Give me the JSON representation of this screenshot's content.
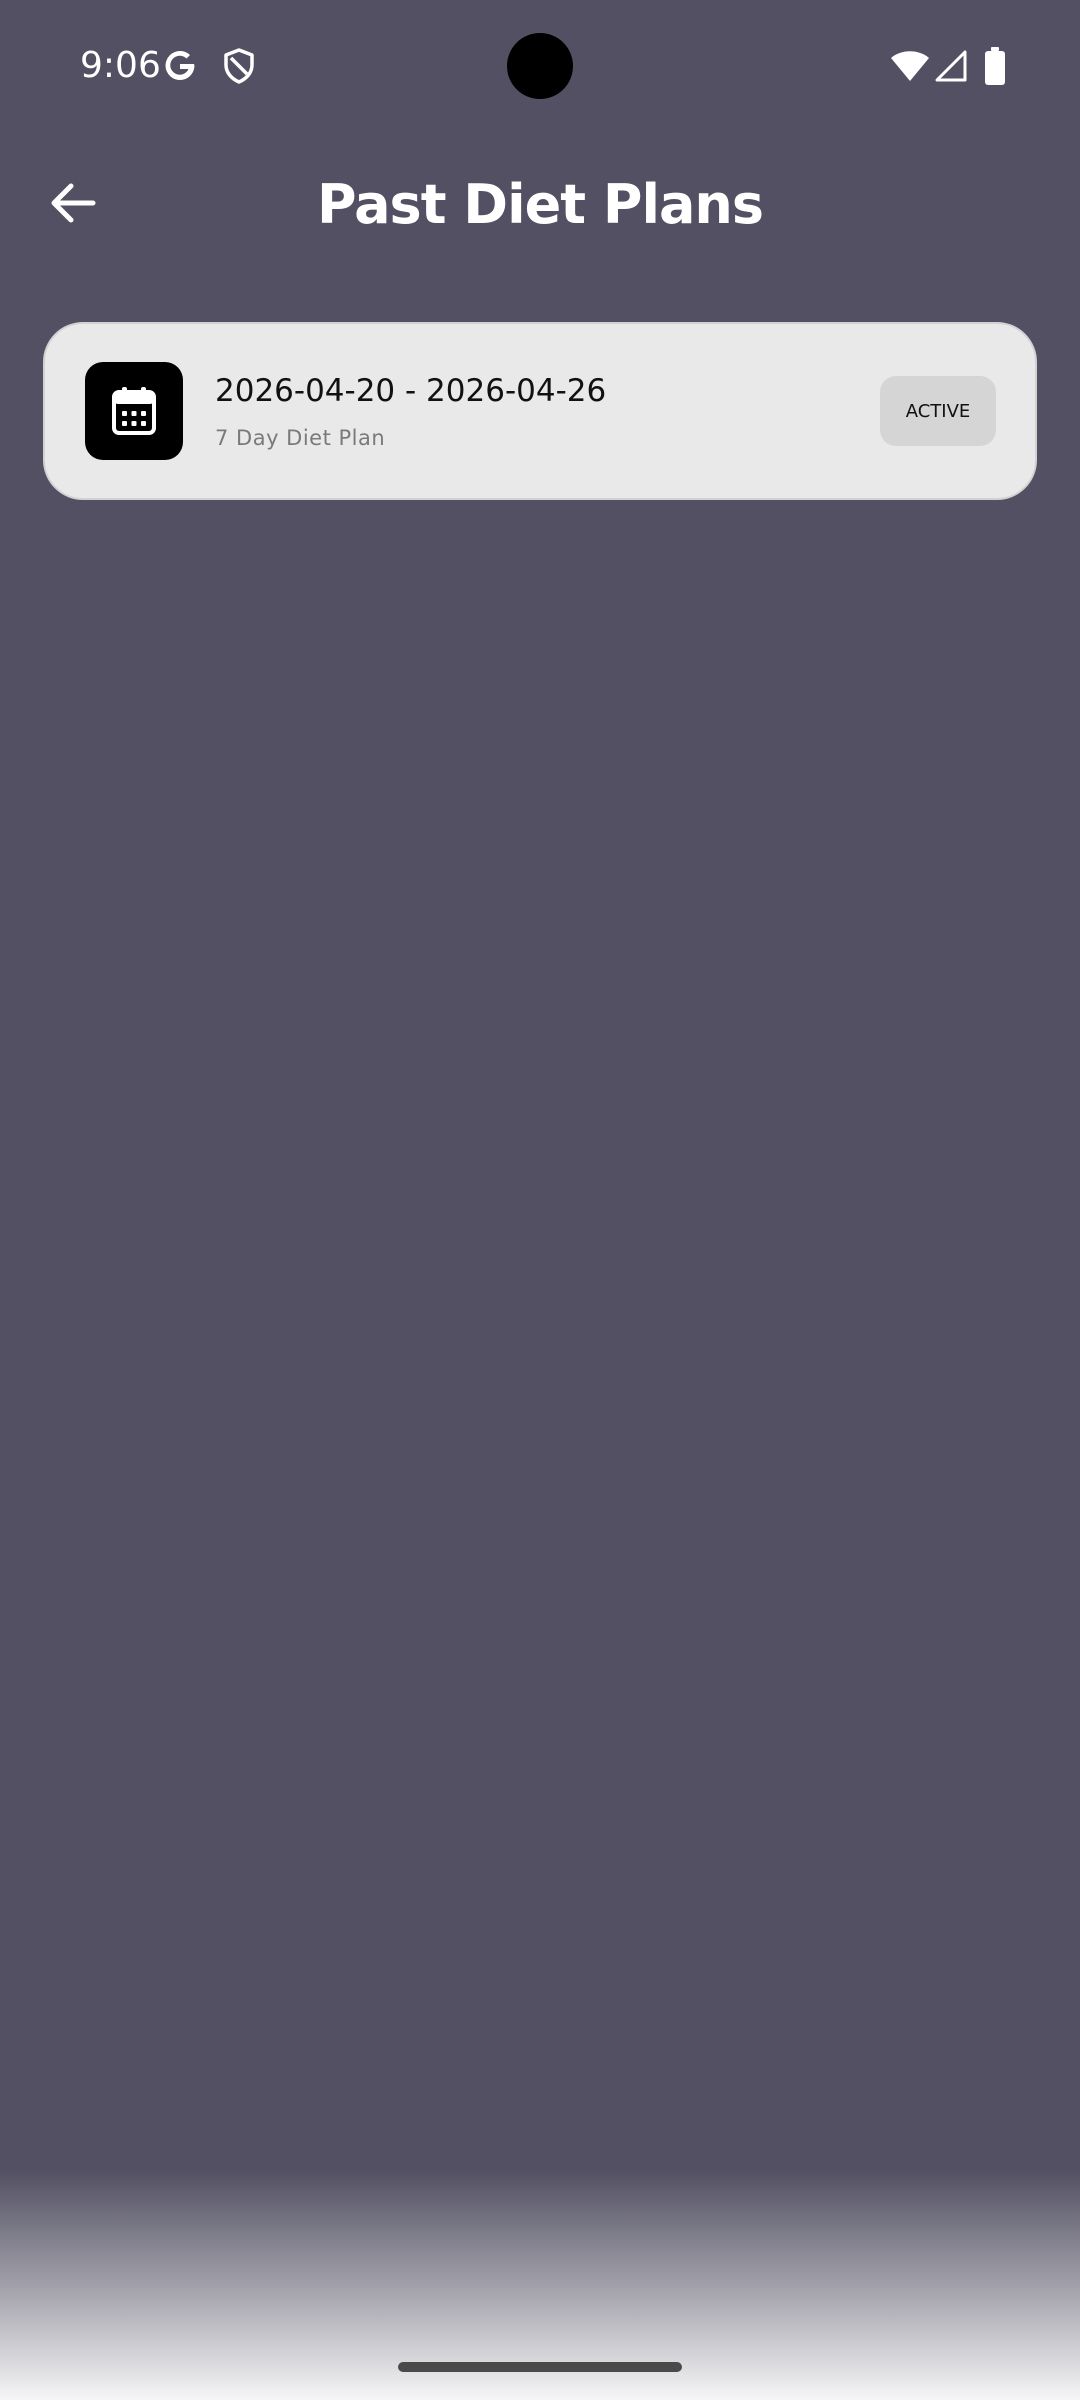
{
  "status_bar": {
    "time": "9:06",
    "icons": [
      "google-g-icon",
      "shield-icon",
      "wifi-icon",
      "cell-signal-icon",
      "battery-icon"
    ]
  },
  "header": {
    "title": "Past Diet Plans",
    "back_icon": "arrow-left-icon"
  },
  "plans": [
    {
      "icon": "calendar-icon",
      "dates": "2026-04-20 - 2026-04-26",
      "subtitle": "7 Day Diet Plan",
      "status": "ACTIVE"
    }
  ],
  "colors": {
    "background": "#525062",
    "card": "#e9e9e9",
    "badge": "#d5d5d5",
    "icon_box": "#000000",
    "title_text": "#ffffff"
  }
}
